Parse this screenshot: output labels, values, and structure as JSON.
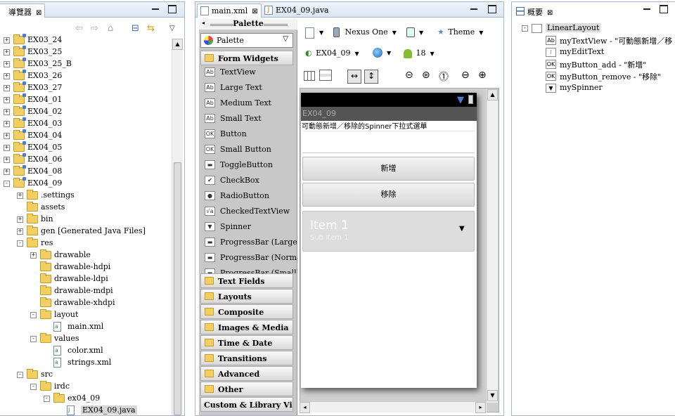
{
  "navigator": {
    "tab_title": "導覽器",
    "items": [
      {
        "label": "EX03_24",
        "depth": 0,
        "exp": "+",
        "type": "project"
      },
      {
        "label": "EX03_25",
        "depth": 0,
        "exp": "+",
        "type": "project"
      },
      {
        "label": "EX03_25_B",
        "depth": 0,
        "exp": "+",
        "type": "project"
      },
      {
        "label": "EX03_26",
        "depth": 0,
        "exp": "+",
        "type": "project"
      },
      {
        "label": "EX03_27",
        "depth": 0,
        "exp": "+",
        "type": "project"
      },
      {
        "label": "EX04_01",
        "depth": 0,
        "exp": "+",
        "type": "project"
      },
      {
        "label": "EX04_02",
        "depth": 0,
        "exp": "+",
        "type": "project"
      },
      {
        "label": "EX04_03",
        "depth": 0,
        "exp": "+",
        "type": "project"
      },
      {
        "label": "EX04_04",
        "depth": 0,
        "exp": "+",
        "type": "project"
      },
      {
        "label": "EX04_05",
        "depth": 0,
        "exp": "+",
        "type": "project"
      },
      {
        "label": "EX04_06",
        "depth": 0,
        "exp": "+",
        "type": "project"
      },
      {
        "label": "EX04_08",
        "depth": 0,
        "exp": "+",
        "type": "project"
      },
      {
        "label": "EX04_09",
        "depth": 0,
        "exp": "-",
        "type": "project"
      },
      {
        "label": ".settings",
        "depth": 1,
        "exp": "+",
        "type": "folder"
      },
      {
        "label": "assets",
        "depth": 1,
        "exp": "",
        "type": "folder"
      },
      {
        "label": "bin",
        "depth": 1,
        "exp": "+",
        "type": "folder"
      },
      {
        "label": "gen [Generated Java Files]",
        "depth": 1,
        "exp": "+",
        "type": "folder"
      },
      {
        "label": "res",
        "depth": 1,
        "exp": "-",
        "type": "folder"
      },
      {
        "label": "drawable",
        "depth": 2,
        "exp": "+",
        "type": "folder"
      },
      {
        "label": "drawable-hdpi",
        "depth": 2,
        "exp": "",
        "type": "folder"
      },
      {
        "label": "drawable-ldpi",
        "depth": 2,
        "exp": "",
        "type": "folder"
      },
      {
        "label": "drawable-mdpi",
        "depth": 2,
        "exp": "",
        "type": "folder"
      },
      {
        "label": "drawable-xhdpi",
        "depth": 2,
        "exp": "",
        "type": "folder"
      },
      {
        "label": "layout",
        "depth": 2,
        "exp": "-",
        "type": "folder"
      },
      {
        "label": "main.xml",
        "depth": 3,
        "exp": "",
        "type": "xml"
      },
      {
        "label": "values",
        "depth": 2,
        "exp": "-",
        "type": "folder"
      },
      {
        "label": "color.xml",
        "depth": 3,
        "exp": "",
        "type": "xml"
      },
      {
        "label": "strings.xml",
        "depth": 3,
        "exp": "",
        "type": "xml"
      },
      {
        "label": "src",
        "depth": 1,
        "exp": "-",
        "type": "folder"
      },
      {
        "label": "irdc",
        "depth": 2,
        "exp": "-",
        "type": "folder"
      },
      {
        "label": "ex04_09",
        "depth": 3,
        "exp": "-",
        "type": "folder"
      },
      {
        "label": "EX04_09.java",
        "depth": 4,
        "exp": "",
        "type": "java"
      }
    ]
  },
  "editor": {
    "tabs": [
      {
        "label": "main.xml",
        "active": true
      },
      {
        "label": "EX04_09.java",
        "active": false
      }
    ],
    "palette": {
      "title": "Palette",
      "dropdown": "Palette",
      "open_category": "Form Widgets",
      "widgets": [
        {
          "label": "TextView",
          "icon": "Ab"
        },
        {
          "label": "Large Text",
          "icon": "Ab"
        },
        {
          "label": "Medium Text",
          "icon": "Ab"
        },
        {
          "label": "Small Text",
          "icon": "Ab"
        },
        {
          "label": "Button",
          "icon": "OK"
        },
        {
          "label": "Small Button",
          "icon": "OK"
        },
        {
          "label": "ToggleButton",
          "icon": "▬"
        },
        {
          "label": "CheckBox",
          "icon": "✔"
        },
        {
          "label": "RadioButton",
          "icon": "●"
        },
        {
          "label": "CheckedTextView",
          "icon": "√a"
        },
        {
          "label": "Spinner",
          "icon": "▼"
        },
        {
          "label": "ProgressBar (Large)",
          "icon": "▬"
        },
        {
          "label": "ProgressBar (Normal)",
          "icon": "▬"
        },
        {
          "label": "ProgressBar (Small)",
          "icon": "▬"
        }
      ],
      "categories": [
        "Text Fields",
        "Layouts",
        "Composite",
        "Images & Media",
        "Time & Date",
        "Transitions",
        "Advanced",
        "Other",
        "Custom & Library Views"
      ]
    },
    "toolbar": {
      "device": "Nexus One",
      "theme": "Theme",
      "activity": "EX04_09",
      "api": "18"
    },
    "preview": {
      "app_title": "EX04_09",
      "textview": "可動態新增／移除的Spinner下拉式選單",
      "button_add": "新增",
      "button_remove": "移除",
      "spinner_item": "Item 1",
      "spinner_sub": "Sub Item 1"
    }
  },
  "outline": {
    "tab_title": "概要",
    "root": "LinearLayout",
    "items": [
      {
        "icon": "Ab",
        "label": "myTextView - \"可動態新增／移"
      },
      {
        "icon": "I",
        "label": "myEditText"
      },
      {
        "icon": "OK",
        "label": "myButton_add - \"新增\""
      },
      {
        "icon": "OK",
        "label": "myButton_remove - \"移除\""
      },
      {
        "icon": "▼",
        "label": "mySpinner"
      }
    ]
  }
}
